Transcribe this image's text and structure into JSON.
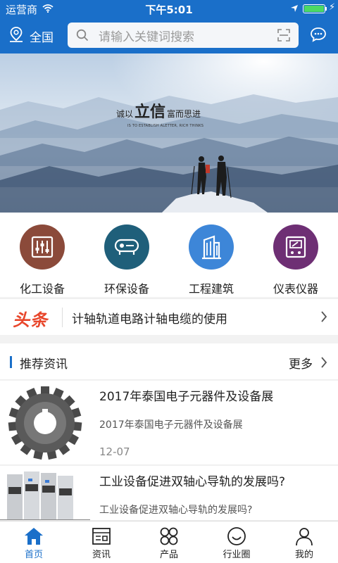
{
  "status": {
    "carrier": "运营商",
    "time": "下午5:01"
  },
  "header": {
    "location": "全国",
    "search_placeholder": "请输入关键词搜索"
  },
  "banner": {
    "slogan_left": "诚以",
    "slogan_big": "立信",
    "slogan_right": "富而思进",
    "tagline": "IS TO ESTABLISH ALETTER, RICH THINKS"
  },
  "categories": [
    {
      "label": "化工设备",
      "color": "#8b4a3a"
    },
    {
      "label": "环保设备",
      "color": "#1f5f7a"
    },
    {
      "label": "工程建筑",
      "color": "#3d86d8"
    },
    {
      "label": "仪表仪器",
      "color": "#6e2f74"
    }
  ],
  "headline": {
    "badge": "头条",
    "text": "计轴轨道电路计轴电缆的使用"
  },
  "section": {
    "title": "推荐资讯",
    "more": "更多"
  },
  "news": [
    {
      "title": "2017年泰国电子元器件及设备展",
      "summary": "2017年泰国电子元器件及设备展",
      "date": "12-07"
    },
    {
      "title": "工业设备促进双轴心导轨的发展吗?",
      "summary": "工业设备促进双轴心导轨的发展吗?",
      "date": ""
    }
  ],
  "tabs": [
    {
      "label": "首页",
      "icon": "home-icon",
      "active": true
    },
    {
      "label": "资讯",
      "icon": "news-icon",
      "active": false
    },
    {
      "label": "产品",
      "icon": "grid-icon",
      "active": false
    },
    {
      "label": "行业圈",
      "icon": "smile-icon",
      "active": false
    },
    {
      "label": "我的",
      "icon": "user-icon",
      "active": false
    }
  ],
  "colors": {
    "primary": "#1a6fc9",
    "headline_red": "#e8462b"
  }
}
